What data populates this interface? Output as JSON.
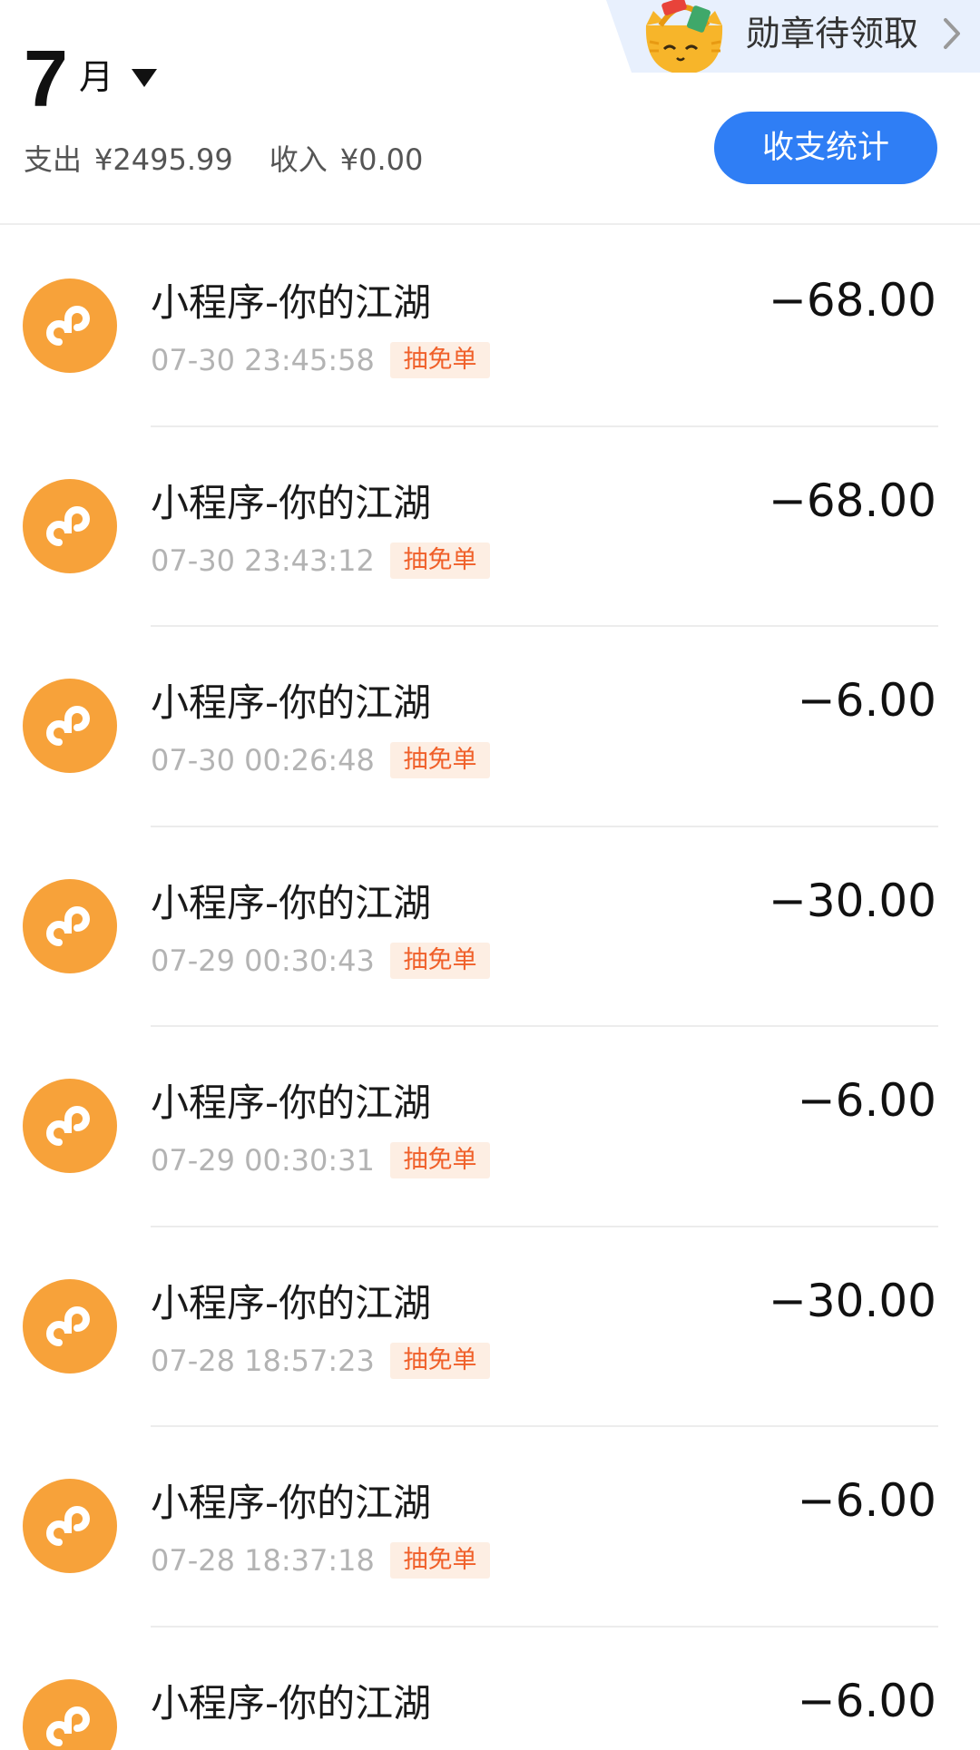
{
  "header": {
    "month_number": "7",
    "month_unit": "月",
    "expense_label": "支出",
    "expense_value": "¥2495.99",
    "income_label": "收入",
    "income_value": "¥0.00",
    "stats_button_label": "收支统计"
  },
  "badge_banner": {
    "text": "勋章待领取",
    "mascot_icon": "cat-shopping-bag-mascot-icon",
    "chevron_icon": "chevron-right-icon"
  },
  "colors": {
    "accent_blue": "#2f7ef5",
    "avatar_orange": "#f7a23a",
    "tag_text": "#f0602a",
    "tag_bg": "#fdeee3"
  },
  "transactions": [
    {
      "title": "小程序-你的江湖",
      "time": "07-30 23:45:58",
      "tag": "抽免单",
      "amount": "−68.00",
      "icon": "mini-program-icon"
    },
    {
      "title": "小程序-你的江湖",
      "time": "07-30 23:43:12",
      "tag": "抽免单",
      "amount": "−68.00",
      "icon": "mini-program-icon"
    },
    {
      "title": "小程序-你的江湖",
      "time": "07-30 00:26:48",
      "tag": "抽免单",
      "amount": "−6.00",
      "icon": "mini-program-icon"
    },
    {
      "title": "小程序-你的江湖",
      "time": "07-29 00:30:43",
      "tag": "抽免单",
      "amount": "−30.00",
      "icon": "mini-program-icon"
    },
    {
      "title": "小程序-你的江湖",
      "time": "07-29 00:30:31",
      "tag": "抽免单",
      "amount": "−6.00",
      "icon": "mini-program-icon"
    },
    {
      "title": "小程序-你的江湖",
      "time": "07-28 18:57:23",
      "tag": "抽免单",
      "amount": "−30.00",
      "icon": "mini-program-icon"
    },
    {
      "title": "小程序-你的江湖",
      "time": "07-28 18:37:18",
      "tag": "抽免单",
      "amount": "−6.00",
      "icon": "mini-program-icon"
    },
    {
      "title": "小程序-你的江湖",
      "time": "",
      "tag": "",
      "amount": "−6.00",
      "icon": "mini-program-icon"
    }
  ]
}
